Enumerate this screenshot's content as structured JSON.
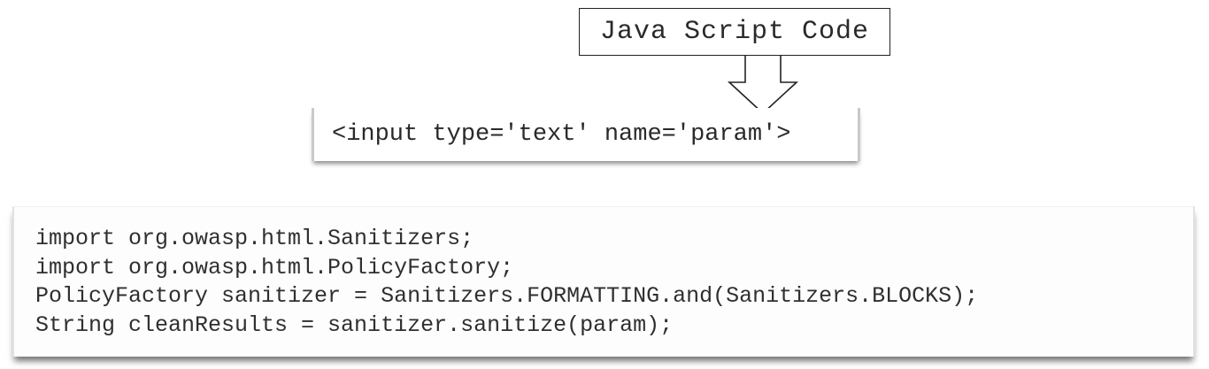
{
  "label": "Java Script Code",
  "input_html": "<input type='text' name='param'>",
  "code_lines": [
    "import org.owasp.html.Sanitizers;",
    "import org.owasp.html.PolicyFactory;",
    "PolicyFactory sanitizer = Sanitizers.FORMATTING.and(Sanitizers.BLOCKS);",
    "String cleanResults = sanitizer.sanitize(param);"
  ]
}
